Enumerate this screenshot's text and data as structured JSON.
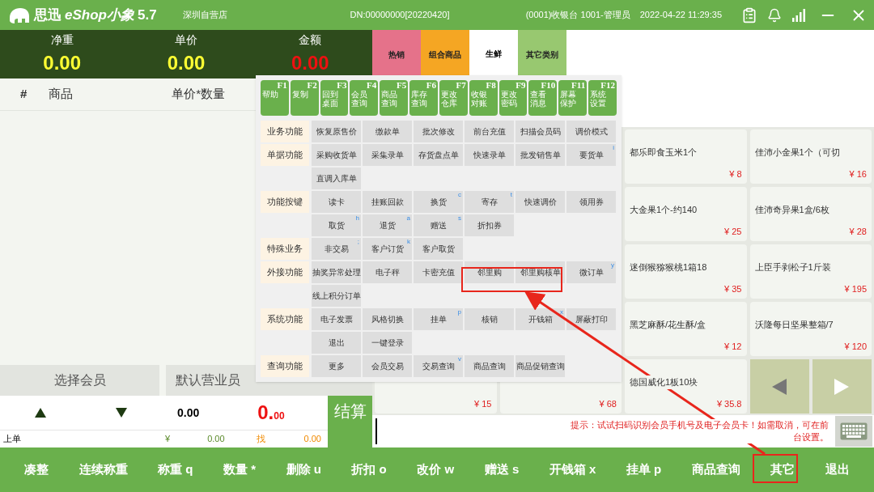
{
  "header": {
    "brand": "思迅",
    "product": "eShop小象",
    "version": "5.7",
    "store": "深圳自营店",
    "dn": "DN:00000000[20220420]",
    "cashier": "(0001)收银台 1001-管理员",
    "datetime": "2022-04-22 11:29:35"
  },
  "scale": [
    {
      "label": "净重",
      "value": "0.00",
      "kind": "normal"
    },
    {
      "label": "单价",
      "value": "0.00",
      "kind": "normal"
    },
    {
      "label": "金额",
      "value": "0.00",
      "kind": "amount"
    }
  ],
  "categories": [
    {
      "label": "热销",
      "color": "#e5728a",
      "selected": false
    },
    {
      "label": "组合商品",
      "color": "#f5a623",
      "selected": false
    },
    {
      "label": "生鲜",
      "color": "#ffffff",
      "selected": true
    },
    {
      "label": "其它类别",
      "color": "#98c870",
      "selected": false
    }
  ],
  "cart": {
    "columns": [
      "#",
      "商品",
      "单价*数量"
    ]
  },
  "member_button": "选择会员",
  "staff_button": "默认营业员",
  "totals": {
    "quantity": "0.00",
    "amount_main": "0.",
    "amount_cents": "00"
  },
  "summary": {
    "label": "上单",
    "paid_symbol": "¥",
    "paid": "0.00",
    "change_label": "找",
    "change": "0.00"
  },
  "checkout": "结算",
  "hint": "提示：试试扫码识别会员手机号及电子会员卡！如需取消，可在前台设置。",
  "products": [
    {
      "name": "都乐即食玉米1个",
      "price": "¥ 8"
    },
    {
      "name": "佳沛小金果1个（可切",
      "price": "¥ 16"
    },
    {
      "name": "大金果1个-约140",
      "price": "¥ 25"
    },
    {
      "name": "佳沛奇异果1盒/6枚",
      "price": "¥ 28"
    },
    {
      "name": "迷倒猴猕猴桃1箱18",
      "price": "¥ 35"
    },
    {
      "name": "上臣手剥松子1斤装",
      "price": "¥ 195"
    },
    {
      "name": "黑芝麻酥/花生酥/盒",
      "price": "¥ 12"
    },
    {
      "name": "沃隆每日坚果整箱/7",
      "price": "¥ 120"
    }
  ],
  "bottom_products": [
    {
      "price": "¥ 15"
    },
    {
      "price": "¥ 68"
    },
    {
      "name": "德国威化1板10块",
      "price": "¥ 35.8"
    }
  ],
  "popup": {
    "function_keys": [
      {
        "key": "F1",
        "label": "帮助"
      },
      {
        "key": "F2",
        "label": "复制"
      },
      {
        "key": "F3",
        "label": "回到桌面"
      },
      {
        "key": "F4",
        "label": "会员查询"
      },
      {
        "key": "F5",
        "label": "商品查询"
      },
      {
        "key": "F6",
        "label": "库存查询"
      },
      {
        "key": "F7",
        "label": "更改仓库"
      },
      {
        "key": "F8",
        "label": "收银对账"
      },
      {
        "key": "F9",
        "label": "更改密码"
      },
      {
        "key": "F10",
        "label": "查看消息"
      },
      {
        "key": "F11",
        "label": "屏幕保护"
      },
      {
        "key": "F12",
        "label": "系统设置"
      }
    ],
    "groups": [
      {
        "label": "业务功能",
        "buttons": [
          {
            "label": "恢复原售价"
          },
          {
            "label": "缴款单"
          },
          {
            "label": "批次修改"
          },
          {
            "label": "前台充值"
          },
          {
            "label": "扫描会员码"
          },
          {
            "label": "调价模式"
          }
        ]
      },
      {
        "label": "单据功能",
        "buttons": [
          {
            "label": "采购收货单"
          },
          {
            "label": "采集录单"
          },
          {
            "label": "存货盘点单"
          },
          {
            "label": "快速录单"
          },
          {
            "label": "批发销售单"
          },
          {
            "label": "要货单",
            "hotkey": "i"
          },
          {
            "label": "直调入库单"
          }
        ]
      },
      {
        "label": "功能按键",
        "buttons": [
          {
            "label": "读卡"
          },
          {
            "label": "挂账回款"
          },
          {
            "label": "换货",
            "hotkey": "c"
          },
          {
            "label": "寄存",
            "hotkey": "t"
          },
          {
            "label": "快速调价"
          },
          {
            "label": "领用券"
          },
          {
            "label": "取货",
            "hotkey": "h"
          },
          {
            "label": "退货",
            "hotkey": "a"
          },
          {
            "label": "赠送",
            "hotkey": "s"
          },
          {
            "label": "折扣券"
          }
        ]
      },
      {
        "label": "特殊业务",
        "buttons": [
          {
            "label": "非交易",
            "hotkey": ";"
          },
          {
            "label": "客户订货",
            "hotkey": "k"
          },
          {
            "label": "客户取货"
          }
        ]
      },
      {
        "label": "外接功能",
        "buttons": [
          {
            "label": "抽奖异常处理"
          },
          {
            "label": "电子秤"
          },
          {
            "label": "卡密充值"
          },
          {
            "label": "邻里购"
          },
          {
            "label": "邻里购核单"
          },
          {
            "label": "微订单",
            "hotkey": "y"
          },
          {
            "label": "线上积分订单"
          }
        ]
      },
      {
        "label": "系统功能",
        "buttons": [
          {
            "label": "电子发票"
          },
          {
            "label": "风格切换"
          },
          {
            "label": "挂单",
            "hotkey": "p"
          },
          {
            "label": "核销"
          },
          {
            "label": "开钱箱",
            "hotkey": "x"
          },
          {
            "label": "屏蔽打印"
          },
          {
            "label": "退出"
          },
          {
            "label": "一键登录"
          }
        ]
      },
      {
        "label": "查询功能",
        "buttons": [
          {
            "label": "更多"
          },
          {
            "label": "会员交易"
          },
          {
            "label": "交易查询",
            "hotkey": "v"
          },
          {
            "label": "商品查询"
          },
          {
            "label": "商品促销查询"
          }
        ]
      }
    ]
  },
  "bottom_bar": [
    "凑整",
    "连续称重",
    "称重 q",
    "数量 *",
    "删除 u",
    "折扣 o",
    "改价 w",
    "赠送 s",
    "开钱箱 x",
    "挂单 p",
    "商品查询",
    "其它",
    "退出"
  ]
}
